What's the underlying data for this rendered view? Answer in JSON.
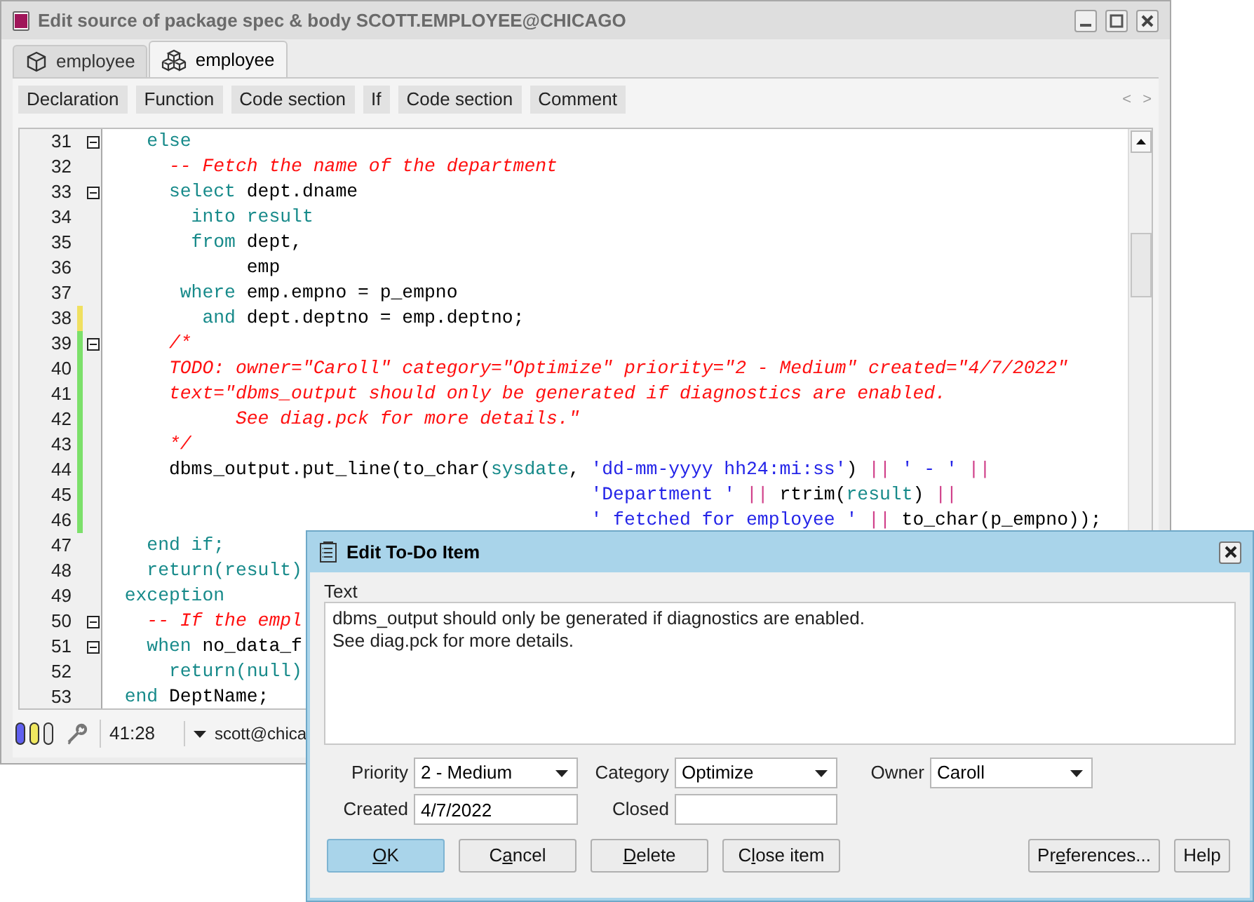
{
  "window": {
    "title": "Edit source of package spec & body SCOTT.EMPLOYEE@CHICAGO"
  },
  "tabs": [
    {
      "label": "employee",
      "kind": "spec",
      "selected": false
    },
    {
      "label": "employee",
      "kind": "body",
      "selected": true
    }
  ],
  "toolbar": {
    "items": [
      "Declaration",
      "Function",
      "Code section",
      "If",
      "Code section",
      "Comment"
    ],
    "nav": [
      "<",
      ">"
    ]
  },
  "editor": {
    "lines": [
      {
        "number": "31",
        "fold": true,
        "tokens": [
          {
            "kind": "keyword",
            "text": "    else"
          }
        ]
      },
      {
        "number": "32",
        "fold": false,
        "tokens": [
          {
            "kind": "comment",
            "text": "      -- Fetch the name of the department"
          }
        ]
      },
      {
        "number": "33",
        "fold": true,
        "tokens": [
          {
            "kind": "keyword",
            "text": "      select"
          },
          {
            "kind": "plain",
            "text": " dept.dname"
          }
        ]
      },
      {
        "number": "34",
        "fold": false,
        "tokens": [
          {
            "kind": "keyword",
            "text": "        into result"
          }
        ]
      },
      {
        "number": "35",
        "fold": false,
        "tokens": [
          {
            "kind": "keyword",
            "text": "        from"
          },
          {
            "kind": "plain",
            "text": " dept,"
          }
        ]
      },
      {
        "number": "36",
        "fold": false,
        "tokens": [
          {
            "kind": "plain",
            "text": "             emp"
          }
        ]
      },
      {
        "number": "37",
        "fold": false,
        "tokens": [
          {
            "kind": "keyword",
            "text": "       where"
          },
          {
            "kind": "plain",
            "text": " emp.empno = p_empno"
          }
        ]
      },
      {
        "number": "38",
        "fold": false,
        "color": "#f0e060",
        "tokens": [
          {
            "kind": "keyword",
            "text": "         and"
          },
          {
            "kind": "plain",
            "text": " dept.deptno = emp.deptno;"
          }
        ]
      },
      {
        "number": "39",
        "fold": true,
        "color": "#7ce06a",
        "tokens": [
          {
            "kind": "comment",
            "text": "      /*"
          }
        ]
      },
      {
        "number": "40",
        "fold": false,
        "color": "#7ce06a",
        "tokens": [
          {
            "kind": "comment",
            "text": "      TODO: owner=\"Caroll\" category=\"Optimize\" priority=\"2 - Medium\" created=\"4/7/2022\""
          }
        ]
      },
      {
        "number": "41",
        "fold": false,
        "color": "#7ce06a",
        "tokens": [
          {
            "kind": "comment",
            "text": "      text=\"dbms_output should only be generated if diagnostics are enabled."
          }
        ]
      },
      {
        "number": "42",
        "fold": false,
        "color": "#7ce06a",
        "tokens": [
          {
            "kind": "comment",
            "text": "            See diag.pck for more details.\""
          }
        ]
      },
      {
        "number": "43",
        "fold": false,
        "color": "#7ce06a",
        "tokens": [
          {
            "kind": "comment",
            "text": "      */"
          }
        ]
      },
      {
        "number": "44",
        "fold": false,
        "color": "#7ce06a",
        "tokens": [
          {
            "kind": "plain",
            "text": "      dbms_output.put_line(to_char("
          },
          {
            "kind": "keyword",
            "text": "sysdate"
          },
          {
            "kind": "plain",
            "text": ", "
          },
          {
            "kind": "string",
            "text": "'dd-mm-yyyy hh24:mi:ss'"
          },
          {
            "kind": "plain",
            "text": ") "
          },
          {
            "kind": "operator",
            "text": "||"
          },
          {
            "kind": "string",
            "text": " ' - '"
          },
          {
            "kind": "operator",
            "text": " ||"
          }
        ]
      },
      {
        "number": "45",
        "fold": false,
        "color": "#7ce06a",
        "tokens": [
          {
            "kind": "string",
            "text": "                                            'Department '"
          },
          {
            "kind": "operator",
            "text": " ||"
          },
          {
            "kind": "plain",
            "text": " rtrim("
          },
          {
            "kind": "keyword",
            "text": "result"
          },
          {
            "kind": "plain",
            "text": ") "
          },
          {
            "kind": "operator",
            "text": "||"
          }
        ]
      },
      {
        "number": "46",
        "fold": false,
        "color": "#7ce06a",
        "tokens": [
          {
            "kind": "string",
            "text": "                                            ' fetched for employee '"
          },
          {
            "kind": "operator",
            "text": " ||"
          },
          {
            "kind": "plain",
            "text": " to_char(p_empno));"
          }
        ]
      },
      {
        "number": "47",
        "fold": false,
        "tokens": [
          {
            "kind": "keyword",
            "text": "    end if;"
          }
        ]
      },
      {
        "number": "48",
        "fold": false,
        "tokens": [
          {
            "kind": "keyword",
            "text": "    return(result)"
          }
        ]
      },
      {
        "number": "49",
        "fold": false,
        "tokens": [
          {
            "kind": "keyword",
            "text": "  exception"
          }
        ]
      },
      {
        "number": "50",
        "fold": true,
        "tokens": [
          {
            "kind": "comment",
            "text": "    -- If the empl"
          }
        ]
      },
      {
        "number": "51",
        "fold": true,
        "tokens": [
          {
            "kind": "keyword",
            "text": "    when"
          },
          {
            "kind": "plain",
            "text": " no_data_f"
          }
        ]
      },
      {
        "number": "52",
        "fold": false,
        "tokens": [
          {
            "kind": "keyword",
            "text": "      return(null)"
          }
        ]
      },
      {
        "number": "53",
        "fold": false,
        "tokens": [
          {
            "kind": "keyword",
            "text": "  end"
          },
          {
            "kind": "plain",
            "text": " DeptName;"
          }
        ]
      }
    ]
  },
  "status_bar": {
    "position": "41:28",
    "connection": "scott@chica"
  },
  "dialog": {
    "title": "Edit To-Do Item",
    "text_label": "Text",
    "text": "dbms_output should only be generated if diagnostics are enabled.\nSee diag.pck for more details.",
    "fields": [
      {
        "label": "Priority",
        "kind": "dropdown",
        "value": "2 - Medium"
      },
      {
        "label": "Category",
        "kind": "dropdown",
        "value": "Optimize"
      },
      {
        "label": "Owner",
        "kind": "dropdown",
        "value": "Caroll"
      },
      {
        "label": "Created",
        "kind": "input",
        "value": "4/7/2022"
      },
      {
        "label": "Closed",
        "kind": "input"
      }
    ],
    "buttons": [
      {
        "parts": [
          {
            "text": "O",
            "underline": true
          },
          {
            "text": "K",
            "underline": false
          }
        ],
        "default": true
      },
      {
        "parts": [
          {
            "text": "C",
            "underline": false
          },
          {
            "text": "a",
            "underline": true
          },
          {
            "text": "ncel",
            "underline": false
          }
        ],
        "default": false
      },
      {
        "parts": [
          {
            "text": "D",
            "underline": true
          },
          {
            "text": "elete",
            "underline": false
          }
        ],
        "default": false
      },
      {
        "parts": [
          {
            "text": "C",
            "underline": false
          },
          {
            "text": "l",
            "underline": true
          },
          {
            "text": "ose item",
            "underline": false
          }
        ],
        "default": false
      },
      {
        "parts": [
          {
            "text": "Pr",
            "underline": false
          },
          {
            "text": "e",
            "underline": true
          },
          {
            "text": "ferences...",
            "underline": false
          }
        ],
        "default": false
      },
      {
        "parts": [
          {
            "text": "Help",
            "underline": false
          }
        ],
        "default": false
      }
    ]
  }
}
